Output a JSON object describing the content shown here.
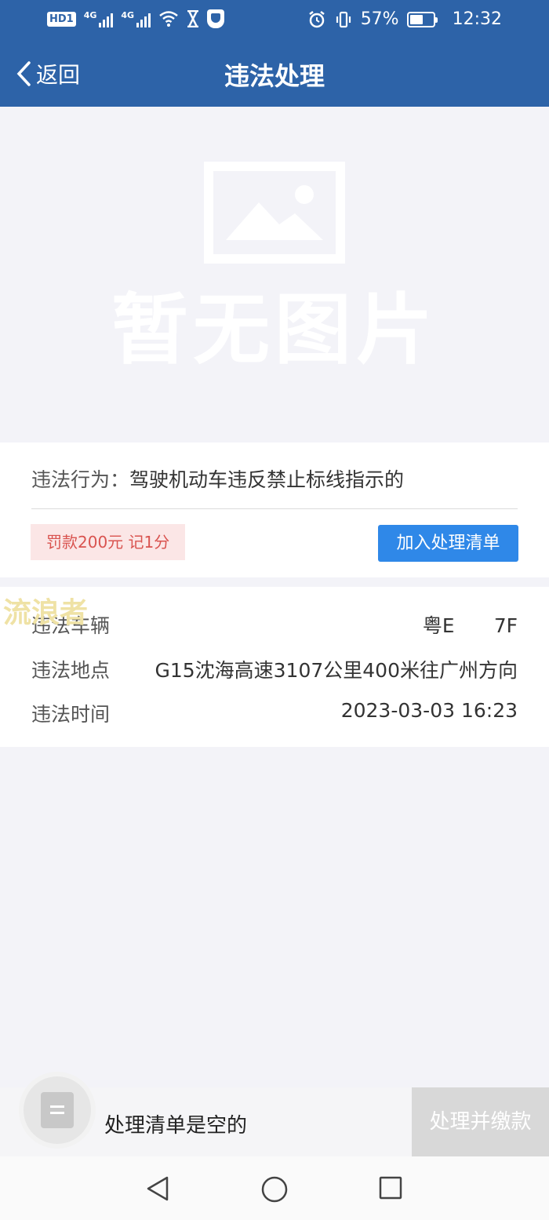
{
  "status_bar": {
    "hd_label": "HD",
    "sim1_label": "1",
    "net_label_1": "4G",
    "net_label_2": "4G",
    "battery_percent": "57%",
    "battery_level": 0.57,
    "time": "12:32"
  },
  "nav": {
    "back_label": "返回",
    "title": "违法处理"
  },
  "photo": {
    "placeholder_text": "暂无图片"
  },
  "violation": {
    "behavior_label": "违法行为：",
    "behavior_value": "驾驶机动车违反禁止标线指示的",
    "penalty": "罚款200元 记1分",
    "add_button": "加入处理清单"
  },
  "details": {
    "vehicle_label": "违法车辆",
    "vehicle_value_prefix": "粤E",
    "vehicle_value_suffix": "7F",
    "location_label": "违法地点",
    "location_value": "G15沈海高速3107公里400米往广州方向",
    "time_label": "违法时间",
    "time_value": "2023-03-03 16:23"
  },
  "watermark": "流浪者",
  "bottom_bar": {
    "list_status": "处理清单是空的",
    "pay_button": "处理并缴款"
  },
  "colors": {
    "header_bg": "#2d63a8",
    "button_blue": "#2f88e8",
    "penalty_bg": "#fbe6e6",
    "penalty_text": "#d9534f",
    "disabled_button": "#d8d8d8"
  },
  "icons": [
    "back-chevron-icon",
    "image-placeholder-icon",
    "list-icon",
    "nav-back-icon",
    "nav-home-icon",
    "nav-recents-icon"
  ]
}
